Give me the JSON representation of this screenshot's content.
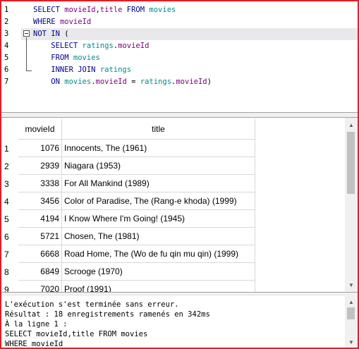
{
  "editor": {
    "lines": [
      {
        "num": "1",
        "tokens": [
          {
            "t": "SELECT ",
            "c": "kw"
          },
          {
            "t": "movieId",
            "c": "fld"
          },
          {
            "t": ",",
            "c": ""
          },
          {
            "t": "title",
            "c": "fld"
          },
          {
            "t": " FROM ",
            "c": "kw"
          },
          {
            "t": "movies",
            "c": "tbl"
          }
        ]
      },
      {
        "num": "2",
        "tokens": [
          {
            "t": "WHERE ",
            "c": "kw"
          },
          {
            "t": "movieId",
            "c": "fld"
          }
        ]
      },
      {
        "num": "3",
        "tokens": [
          {
            "t": "NOT IN ",
            "c": "kw"
          },
          {
            "t": "(",
            "c": ""
          }
        ]
      },
      {
        "num": "4",
        "tokens": [
          {
            "t": "    SELECT ",
            "c": "kw"
          },
          {
            "t": "ratings",
            "c": "tbl"
          },
          {
            "t": ".",
            "c": ""
          },
          {
            "t": "movieId",
            "c": "fld"
          }
        ]
      },
      {
        "num": "5",
        "tokens": [
          {
            "t": "    FROM ",
            "c": "kw"
          },
          {
            "t": "movies",
            "c": "tbl"
          }
        ]
      },
      {
        "num": "6",
        "tokens": [
          {
            "t": "    INNER JOIN ",
            "c": "kw"
          },
          {
            "t": "ratings",
            "c": "tbl"
          }
        ]
      },
      {
        "num": "7",
        "tokens": [
          {
            "t": "    ON ",
            "c": "kw"
          },
          {
            "t": "movies",
            "c": "tbl"
          },
          {
            "t": ".",
            "c": ""
          },
          {
            "t": "movieId",
            "c": "fld"
          },
          {
            "t": " = ",
            "c": ""
          },
          {
            "t": "ratings",
            "c": "tbl"
          },
          {
            "t": ".",
            "c": ""
          },
          {
            "t": "movieId",
            "c": "fld"
          },
          {
            "t": ")",
            "c": ""
          }
        ]
      }
    ]
  },
  "grid": {
    "columns": [
      "movieId",
      "title"
    ],
    "rows": [
      {
        "n": "1",
        "movieId": "1076",
        "title": "Innocents, The (1961)"
      },
      {
        "n": "2",
        "movieId": "2939",
        "title": "Niagara (1953)"
      },
      {
        "n": "3",
        "movieId": "3338",
        "title": "For All Mankind (1989)"
      },
      {
        "n": "4",
        "movieId": "3456",
        "title": "Color of Paradise, The (Rang-e khoda) (1999)"
      },
      {
        "n": "5",
        "movieId": "4194",
        "title": "I Know Where I'm Going! (1945)"
      },
      {
        "n": "6",
        "movieId": "5721",
        "title": "Chosen, The (1981)"
      },
      {
        "n": "7",
        "movieId": "6668",
        "title": "Road Home, The (Wo de fu qin mu qin) (1999)"
      },
      {
        "n": "8",
        "movieId": "6849",
        "title": "Scrooge (1970)"
      },
      {
        "n": "9",
        "movieId": "7020",
        "title": "Proof (1991)"
      }
    ]
  },
  "messages": [
    "L'exécution s'est terminée sans erreur.",
    "Résultat : 18 enregistrements ramenés en 342ms",
    "À la ligne 1 :",
    "SELECT movieId,title FROM movies",
    "WHERE movieId"
  ],
  "colors": {
    "border": "#e81c24",
    "keyword": "#00008b",
    "field": "#800080",
    "table": "#008b8b",
    "current_line": "#e9e9ec"
  }
}
